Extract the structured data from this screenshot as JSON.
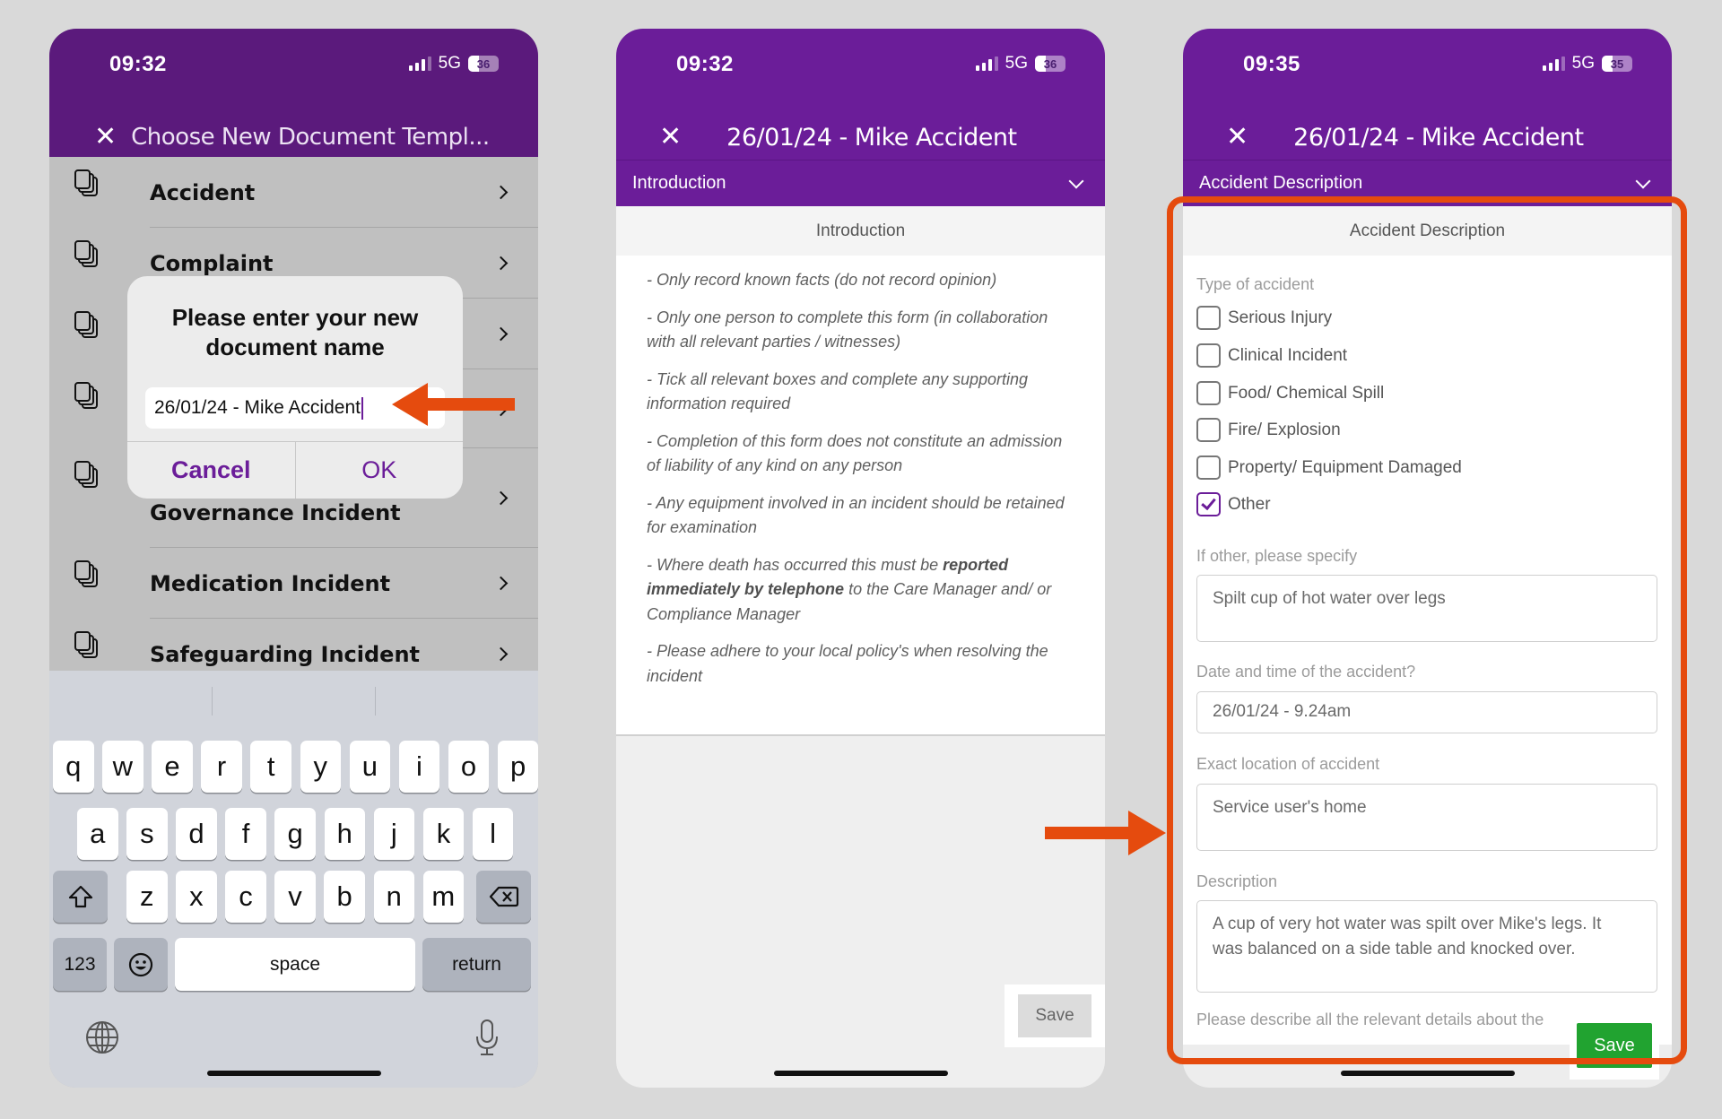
{
  "phones": [
    {
      "status": {
        "time": "09:32",
        "network": "5G",
        "battery": "36",
        "battery_level_pct": 36
      },
      "title": "Choose New Document Templ...",
      "templates": [
        {
          "label": "Accident"
        },
        {
          "label": "Complaint"
        },
        {
          "label": ""
        },
        {
          "label": ""
        },
        {
          "label": "Information Governance Incident"
        },
        {
          "label": "Medication Incident"
        },
        {
          "label": "Safeguarding Incident"
        }
      ],
      "dialog": {
        "title": "Please enter your new document name",
        "input_value": "26/01/24 - Mike Accident",
        "cancel_label": "Cancel",
        "ok_label": "OK"
      },
      "keyboard": {
        "row1": [
          "q",
          "w",
          "e",
          "r",
          "t",
          "y",
          "u",
          "i",
          "o",
          "p"
        ],
        "row2": [
          "a",
          "s",
          "d",
          "f",
          "g",
          "h",
          "j",
          "k",
          "l"
        ],
        "row3": [
          "z",
          "x",
          "c",
          "v",
          "b",
          "n",
          "m"
        ],
        "numbers_label": "123",
        "space_label": "space",
        "return_label": "return"
      }
    },
    {
      "status": {
        "time": "09:32",
        "network": "5G",
        "battery": "36",
        "battery_level_pct": 36
      },
      "title": "26/01/24 - Mike Accident",
      "section": "Introduction",
      "panel_title": "Introduction",
      "intro_items": [
        {
          "text": "- Only record known facts (do not record opinion)"
        },
        {
          "text": "- Only one person to complete this form (in collaboration with all relevant parties / witnesses)"
        },
        {
          "text": "- Tick all relevant boxes and complete any supporting information required"
        },
        {
          "text": "- Completion of this form does not constitute an admission of liability of any kind on any person"
        },
        {
          "text": "- Any equipment involved in an incident should be retained for examination"
        },
        {
          "pre": "- Where death has occurred this must be ",
          "bold": "reported immediately by telephone",
          "post": " to the Care Manager  and/ or Compliance Manager"
        },
        {
          "text": "- Please adhere to your local policy's when resolving the incident"
        }
      ],
      "save_label": "Save"
    },
    {
      "status": {
        "time": "09:35",
        "network": "5G",
        "battery": "35",
        "battery_level_pct": 35
      },
      "title": "26/01/24 - Mike Accident",
      "section": "Accident Description",
      "panel_title": "Accident Description",
      "type_label": "Type of accident",
      "accident_types": [
        {
          "label": "Serious Injury",
          "checked": false
        },
        {
          "label": "Clinical Incident",
          "checked": false
        },
        {
          "label": "Food/ Chemical Spill",
          "checked": false
        },
        {
          "label": "Fire/ Explosion",
          "checked": false
        },
        {
          "label": "Property/ Equipment Damaged",
          "checked": false
        },
        {
          "label": "Other",
          "checked": true
        }
      ],
      "other_label": "If other, please specify",
      "other_value": "Spilt cup of hot water over legs",
      "datetime_label": "Date and time of the accident?",
      "datetime_value": "26/01/24 - 9.24am",
      "location_label": "Exact location of accident",
      "location_value": "Service user's home",
      "description_label": "Description",
      "description_value": "A cup of very hot water was spilt over Mike's legs. It was balanced on a side table and knocked over.",
      "description_hint": "Please describe all the relevant details about the",
      "save_label": "Save"
    }
  ],
  "colors": {
    "brand_purple": "#6b1d99",
    "annotation_orange": "#e54b0e",
    "save_green": "#21a330"
  }
}
